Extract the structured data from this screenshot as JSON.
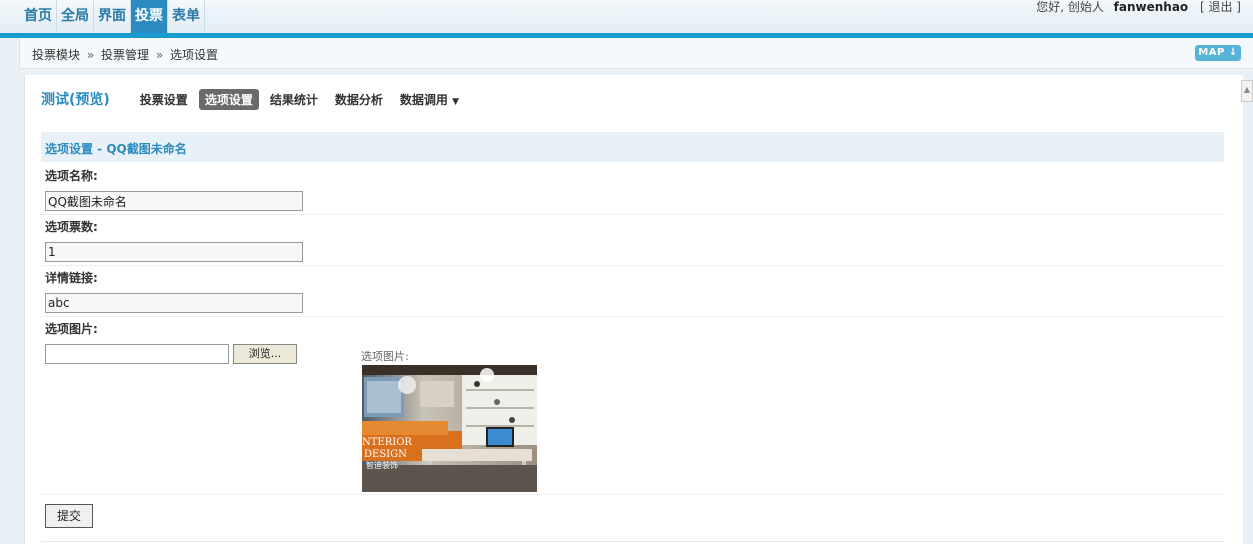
{
  "nav": {
    "items": [
      "首页",
      "全局",
      "界面",
      "投票",
      "表单"
    ],
    "active_index": 3
  },
  "user": {
    "greeting": "您好, 创始人",
    "name": "fanwenhao",
    "logout": "[ 退出 ]"
  },
  "breadcrumb": {
    "items": [
      "投票模块",
      "投票管理",
      "选项设置"
    ],
    "separator": "»",
    "map_label": "MAP"
  },
  "subnav": {
    "title": "测试(预览)",
    "tabs": [
      "投票设置",
      "选项设置",
      "结果统计",
      "数据分析",
      "数据调用"
    ],
    "active_index": 1,
    "dropdown_caret": "▼"
  },
  "section": {
    "heading": "选项设置 - QQ截图未命名"
  },
  "form": {
    "name_label": "选项名称:",
    "name_value": "QQ截图未命名",
    "votes_label": "选项票数:",
    "votes_value": "1",
    "link_label": "详情链接:",
    "link_value": "abc",
    "image_label": "选项图片:",
    "browse_label": "浏览...",
    "image_preview_label": "选项图片:",
    "thumb_text_line1": "NTERIOR",
    "thumb_text_line2": "DESIGN",
    "thumb_text_line3": "智迪装饰",
    "submit_label": "提交"
  }
}
